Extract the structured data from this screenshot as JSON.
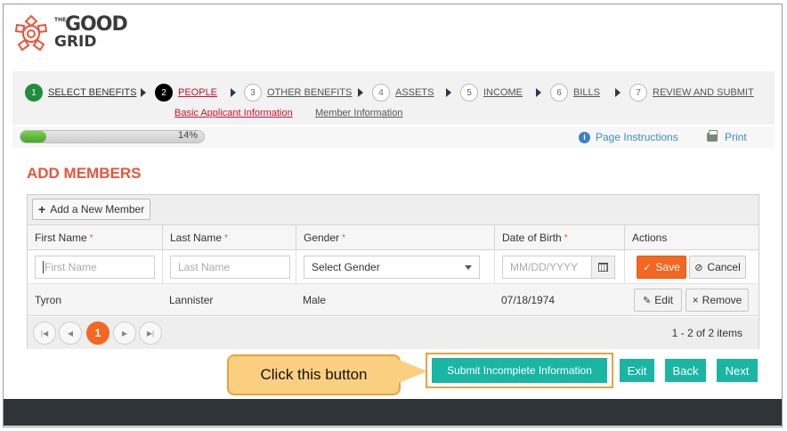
{
  "logo": {
    "the": "THE",
    "good": "GOOD",
    "grid": "GRID"
  },
  "steps": [
    {
      "num": "1",
      "label": "SELECT BENEFITS",
      "state": "done"
    },
    {
      "num": "2",
      "label": "PEOPLE",
      "state": "active"
    },
    {
      "num": "3",
      "label": "OTHER BENEFITS",
      "state": "todo"
    },
    {
      "num": "4",
      "label": "ASSETS",
      "state": "todo"
    },
    {
      "num": "5",
      "label": "INCOME",
      "state": "todo"
    },
    {
      "num": "6",
      "label": "BILLS",
      "state": "todo"
    },
    {
      "num": "7",
      "label": "REVIEW AND SUBMIT",
      "state": "todo"
    }
  ],
  "substeps": [
    {
      "label": "Basic Applicant Information",
      "state": "active"
    },
    {
      "label": "Member Information",
      "state": "inactive"
    }
  ],
  "progress": {
    "value": 0.14,
    "label": "14%"
  },
  "links": {
    "page_instructions": "Page Instructions",
    "print": "Print"
  },
  "page_title": "ADD MEMBERS",
  "grid": {
    "add_button": "Add a New Member",
    "columns": [
      "First Name",
      "Last Name",
      "Gender",
      "Date of Birth",
      "Actions"
    ],
    "required": "*",
    "edit_row": {
      "first_name_placeholder": "First Name",
      "last_name_placeholder": "Last Name",
      "gender_value": "Select Gender",
      "dob_placeholder": "MM/DD/YYYY",
      "save": "Save",
      "cancel": "Cancel"
    },
    "rows": [
      {
        "first_name": "Tyron",
        "last_name": "Lannister",
        "gender": "Male",
        "dob": "07/18/1974",
        "edit": "Edit",
        "remove": "Remove"
      }
    ],
    "pager": {
      "current_page": "1",
      "info": "1 - 2 of 2 items"
    }
  },
  "callout": "Click this button",
  "actions": {
    "submit": "Submit Incomplete Information",
    "exit": "Exit",
    "back": "Back",
    "next": "Next"
  },
  "colors": {
    "accent": "#f26722",
    "teal": "#1bb5a3",
    "title": "#e8553a",
    "active_step": "#c8102e"
  }
}
